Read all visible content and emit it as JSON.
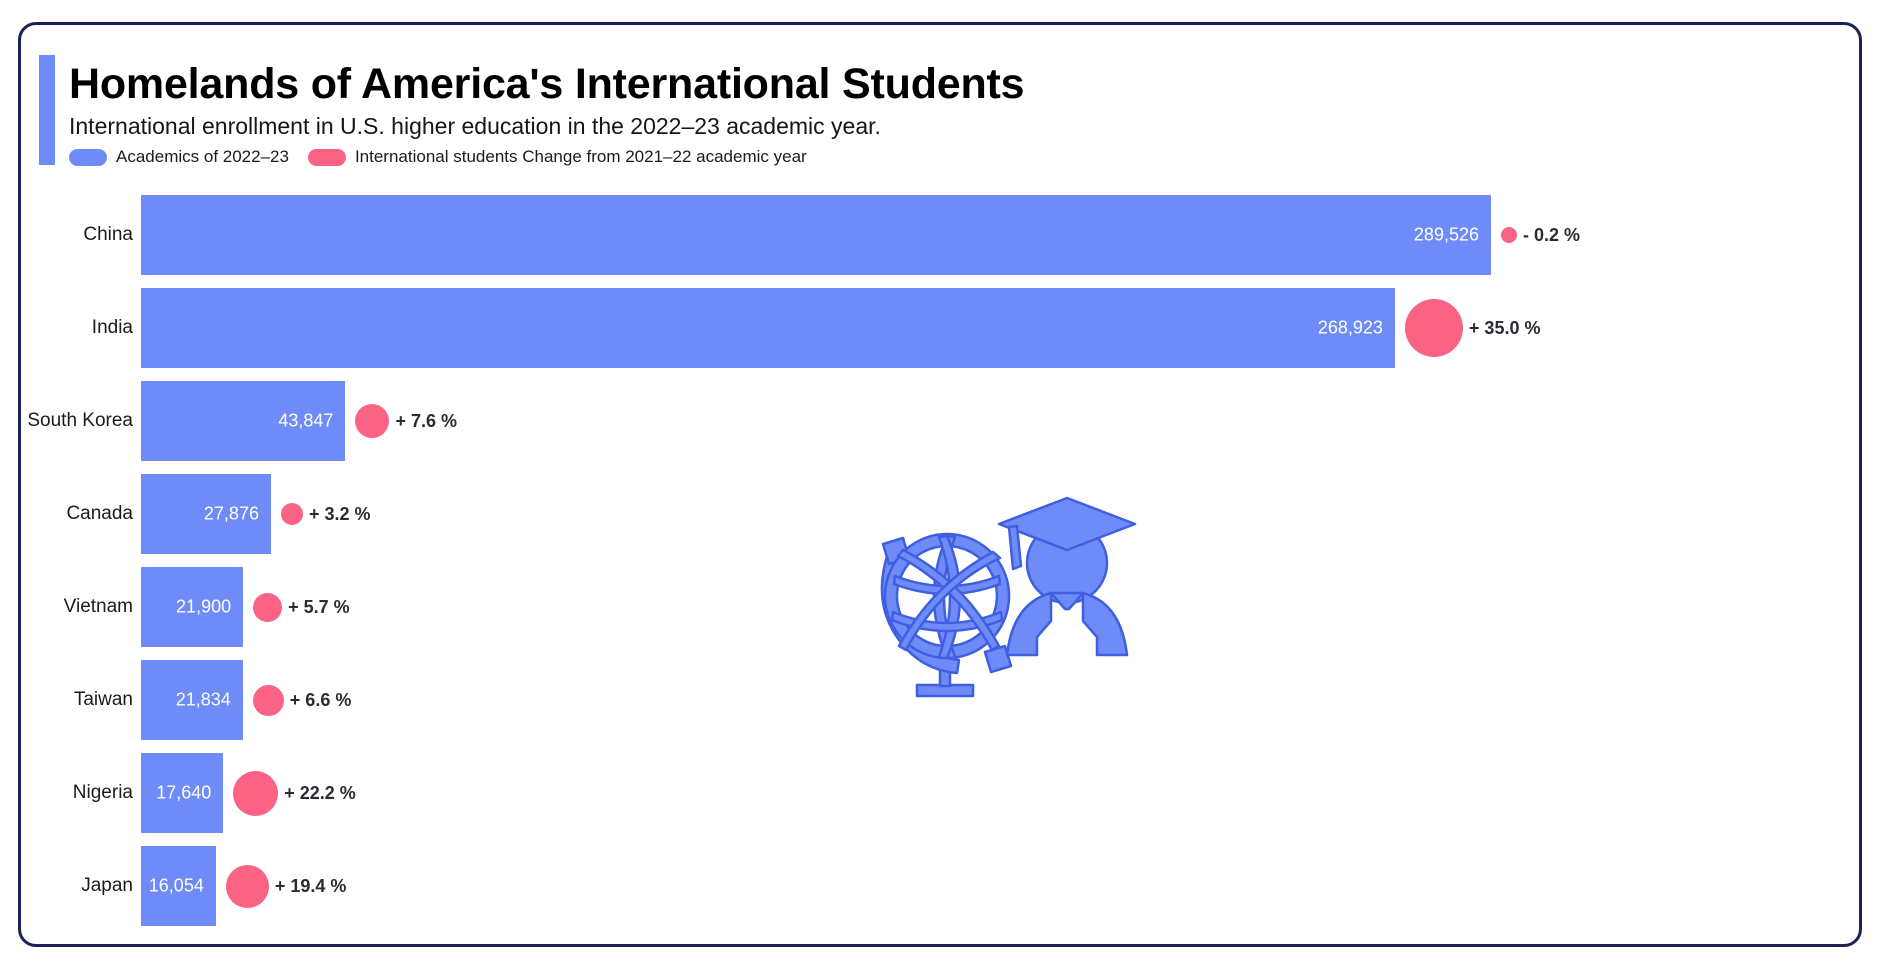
{
  "header": {
    "title": "Homelands of America's International Students",
    "subtitle": "International enrollment in U.S. higher education in the 2022–23 academic year.",
    "accent_color": "#6f8bf8",
    "border_color": "#1c2352"
  },
  "legend": {
    "items": [
      {
        "label": "Academics of 2022–23",
        "color": "#6f8bf8"
      },
      {
        "label": "International students Change from 2021–22 academic year",
        "color": "#fa6383"
      }
    ]
  },
  "illustration": {
    "name": "globe-and-graduate-illustration",
    "color": "#6f8bf8",
    "outline_color": "#3f5fe0"
  },
  "chart_data": {
    "type": "bar",
    "orientation": "horizontal",
    "title": "Homelands of America's International Students",
    "subtitle": "International enrollment in U.S. higher education in the 2022–23 academic year.",
    "xlabel": "",
    "ylabel": "",
    "grid": false,
    "legend_position": "top-left",
    "xlim": [
      0,
      289526
    ],
    "categories": [
      "China",
      "India",
      "South Korea",
      "Canada",
      "Vietnam",
      "Taiwan",
      "Nigeria",
      "Japan"
    ],
    "values": [
      289526,
      268923,
      43847,
      27876,
      21900,
      21834,
      17640,
      16054
    ],
    "value_labels": [
      "289,526",
      "268,923",
      "43,847",
      "27,876",
      "21,900",
      "21,834",
      "17,640",
      "16,054"
    ],
    "series": [
      {
        "name": "Academics of 2022–23",
        "color": "#6f8bf8",
        "values": [
          289526,
          268923,
          43847,
          27876,
          21900,
          21834,
          17640,
          16054
        ]
      },
      {
        "name": "International students Change from 2021–22 academic year",
        "color": "#fa6383",
        "values": [
          -0.2,
          35.0,
          7.6,
          3.2,
          5.7,
          6.6,
          22.2,
          19.4
        ],
        "labels": [
          "- 0.2 %",
          "+ 35.0 %",
          "+ 7.6 %",
          "+ 3.2 %",
          "+ 5.7 %",
          "+ 6.6 %",
          "+ 22.2 %",
          "+ 19.4 %"
        ],
        "encoding": "bubble-radius"
      }
    ],
    "rows": [
      {
        "category": "China",
        "value": 289526,
        "value_label": "289,526",
        "change": -0.2,
        "change_label": "- 0.2 %",
        "bubble_diameter": 16
      },
      {
        "category": "India",
        "value": 268923,
        "value_label": "268,923",
        "change": 35.0,
        "change_label": "+ 35.0 %",
        "bubble_diameter": 58
      },
      {
        "category": "South Korea",
        "value": 43847,
        "value_label": "43,847",
        "change": 7.6,
        "change_label": "+ 7.6 %",
        "bubble_diameter": 34
      },
      {
        "category": "Canada",
        "value": 27876,
        "value_label": "27,876",
        "change": 3.2,
        "change_label": "+ 3.2 %",
        "bubble_diameter": 22
      },
      {
        "category": "Vietnam",
        "value": 21900,
        "value_label": "21,900",
        "change": 5.7,
        "change_label": "+ 5.7 %",
        "bubble_diameter": 29
      },
      {
        "category": "Taiwan",
        "value": 21834,
        "value_label": "21,834",
        "change": 6.6,
        "change_label": "+ 6.6 %",
        "bubble_diameter": 31
      },
      {
        "category": "Nigeria",
        "value": 17640,
        "value_label": "17,640",
        "change": 22.2,
        "change_label": "+ 22.2 %",
        "bubble_diameter": 45
      },
      {
        "category": "Japan",
        "value": 16054,
        "value_label": "16,054",
        "change": 19.4,
        "change_label": "+ 19.4 %",
        "bubble_diameter": 43
      }
    ]
  }
}
